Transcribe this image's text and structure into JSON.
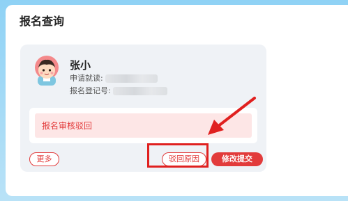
{
  "colors": {
    "accent": "#e23b3b",
    "highlight": "#e0201f",
    "backdrop": "#8fd2f5"
  },
  "page": {
    "title": "报名查询"
  },
  "student": {
    "name": "张小",
    "apply_label": "申请就读:",
    "reg_label": "报名登记号:"
  },
  "status": {
    "text": "报名审核驳回"
  },
  "actions": {
    "more_label": "更多",
    "reason_label": "驳回原因",
    "modify_label": "修改提交"
  },
  "icons": {
    "avatar": "girl-avatar-icon",
    "arrow": "pointer-arrow-icon"
  }
}
